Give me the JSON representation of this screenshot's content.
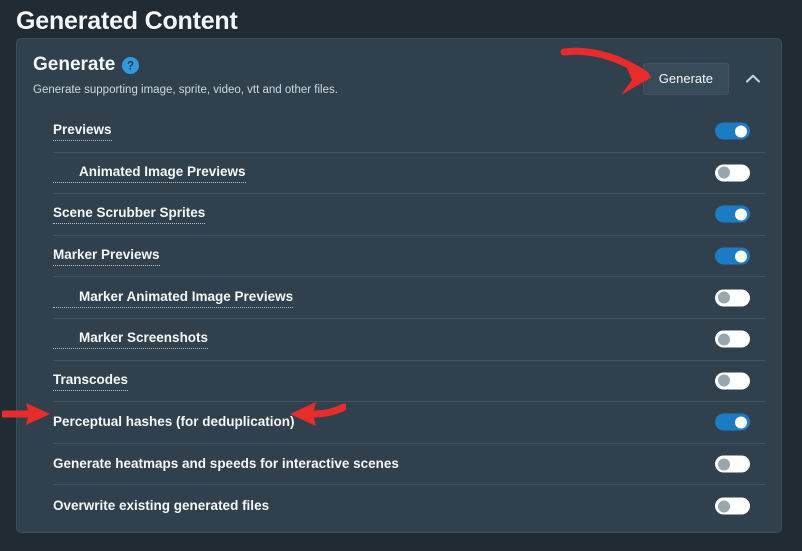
{
  "page": {
    "title": "Generated Content"
  },
  "panel": {
    "section_title": "Generate",
    "help_icon": "question-circle-icon",
    "description": "Generate supporting image, sprite, video, vtt and other files.",
    "generate_button": "Generate",
    "collapse_icon": "chevron-up-icon",
    "accent_color": "#1b7cc4",
    "panel_color": "#30404d",
    "page_background": "#202b33",
    "annotation_color": "#e82c2c"
  },
  "settings": [
    {
      "label": "Previews",
      "indented": false,
      "tooltip": true,
      "enabled": true
    },
    {
      "label": "Animated Image Previews",
      "indented": true,
      "tooltip": true,
      "enabled": false
    },
    {
      "label": "Scene Scrubber Sprites",
      "indented": false,
      "tooltip": true,
      "enabled": true
    },
    {
      "label": "Marker Previews",
      "indented": false,
      "tooltip": true,
      "enabled": true
    },
    {
      "label": "Marker Animated Image Previews",
      "indented": true,
      "tooltip": true,
      "enabled": false
    },
    {
      "label": "Marker Screenshots",
      "indented": true,
      "tooltip": true,
      "enabled": false
    },
    {
      "label": "Transcodes",
      "indented": false,
      "tooltip": true,
      "enabled": false
    },
    {
      "label": "Perceptual hashes (for deduplication)",
      "indented": false,
      "tooltip": false,
      "enabled": true
    },
    {
      "label": "Generate heatmaps and speeds for interactive scenes",
      "indented": false,
      "tooltip": false,
      "enabled": false
    },
    {
      "label": "Overwrite existing generated files",
      "indented": false,
      "tooltip": false,
      "enabled": false
    }
  ],
  "annotations": [
    {
      "name": "arrow-pointing-to-generate-button",
      "direction": "right"
    },
    {
      "name": "arrow-pointing-to-perceptual-hashes-from-left",
      "direction": "right"
    },
    {
      "name": "arrow-pointing-to-perceptual-hashes-from-right",
      "direction": "left"
    }
  ]
}
